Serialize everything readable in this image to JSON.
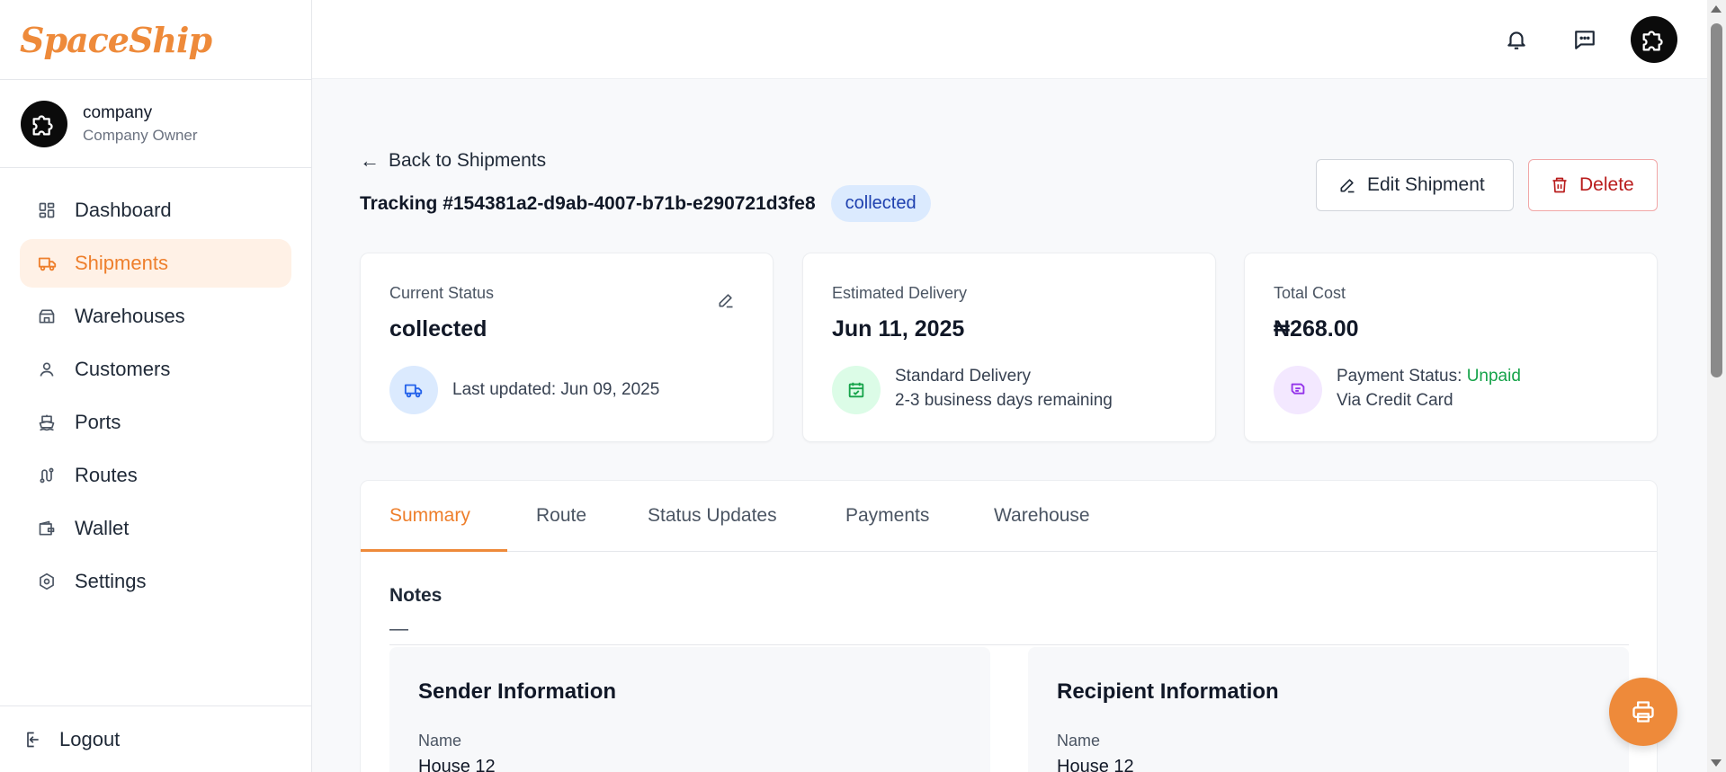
{
  "app": {
    "logo": "SpaceShip"
  },
  "profile": {
    "name": "company",
    "role": "Company Owner"
  },
  "sidebar": {
    "items": [
      {
        "label": "Dashboard",
        "icon": "dashboard-icon"
      },
      {
        "label": "Shipments",
        "icon": "truck-icon",
        "active": true
      },
      {
        "label": "Warehouses",
        "icon": "warehouse-icon"
      },
      {
        "label": "Customers",
        "icon": "user-icon"
      },
      {
        "label": "Ports",
        "icon": "ship-icon"
      },
      {
        "label": "Routes",
        "icon": "route-icon"
      },
      {
        "label": "Wallet",
        "icon": "wallet-icon"
      },
      {
        "label": "Settings",
        "icon": "settings-icon"
      }
    ],
    "logout": "Logout"
  },
  "header": {
    "icons": [
      "bell-icon",
      "message-icon",
      "avatar"
    ]
  },
  "shipment": {
    "back_label": "Back to Shipments",
    "tracking": "Tracking #154381a2-d9ab-4007-b71b-e290721d3fe8",
    "status_badge": "collected",
    "edit_label": "Edit Shipment",
    "delete_label": "Delete"
  },
  "cards": {
    "status": {
      "label": "Current Status",
      "value": "collected",
      "sub": "Last updated: Jun 09, 2025"
    },
    "delivery": {
      "label": "Estimated Delivery",
      "value": "Jun 11, 2025",
      "sub1": "Standard Delivery",
      "sub2": "2-3 business days remaining"
    },
    "cost": {
      "label": "Total Cost",
      "value": "₦268.00",
      "payment_prefix": "Payment Status: ",
      "payment_status": "Unpaid",
      "method": "Via Credit Card"
    }
  },
  "tabs": [
    {
      "label": "Summary",
      "active": true
    },
    {
      "label": "Route"
    },
    {
      "label": "Status Updates"
    },
    {
      "label": "Payments"
    },
    {
      "label": "Warehouse"
    }
  ],
  "summary": {
    "notes_title": "Notes",
    "notes_value": "—",
    "sender": {
      "title": "Sender Information",
      "name_label": "Name",
      "name_value": "House 12"
    },
    "recipient": {
      "title": "Recipient Information",
      "name_label": "Name",
      "name_value": "House 12"
    }
  },
  "colors": {
    "accent": "#ee8a3a",
    "badge_bg": "#dbeafe",
    "unpaid": "#16a34a",
    "delete": "#b91c1c"
  }
}
